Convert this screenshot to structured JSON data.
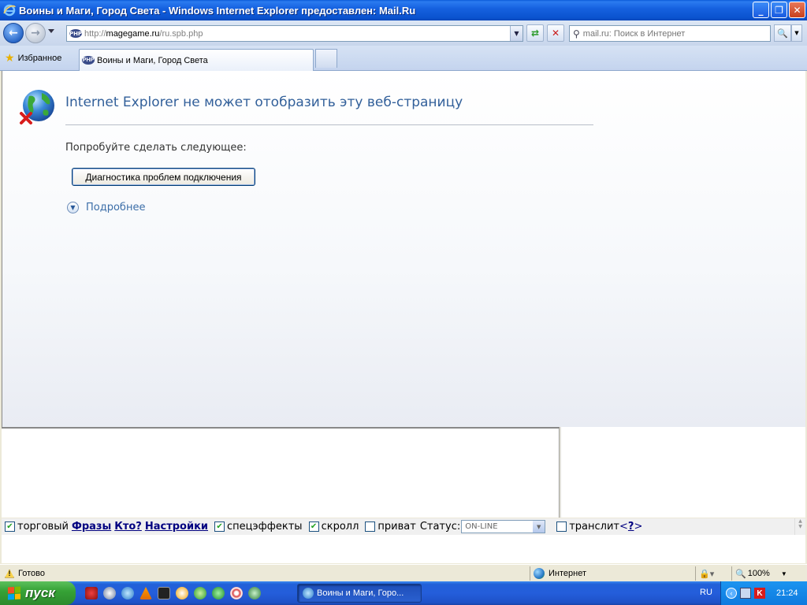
{
  "window": {
    "title": "Воины и Маги, Город Света - Windows Internet Explorer предоставлен: Mail.Ru",
    "buttons": {
      "minimize": "_",
      "maximize": "❐",
      "close": "✕"
    }
  },
  "address_bar": {
    "url_proto": "http://",
    "url_host": "magegame.ru",
    "url_rest": "/ru.spb.php",
    "site_icon": "PHP"
  },
  "search": {
    "placeholder": "mail.ru: Поиск в Интернет"
  },
  "favorites": {
    "label": "Избранное"
  },
  "tab": {
    "title": "Воины и Маги, Город Света",
    "icon": "PHP"
  },
  "error_page": {
    "title": "Internet Explorer не может отобразить эту веб-страницу",
    "suggest": "Попробуйте сделать следующее:",
    "diagnose_button": "Диагностика проблем подключения",
    "more_info": "Подробнее"
  },
  "chat_bar": {
    "trade": {
      "label": "торговый",
      "checked": true
    },
    "phrases_link": "Фразы",
    "who_link": "Кто?",
    "settings_link": "Настройки",
    "effects": {
      "label": "спецэффекты",
      "checked": true
    },
    "scroll": {
      "label": "скролл",
      "checked": true
    },
    "private": {
      "label": "приват",
      "checked": false
    },
    "status_label": "Статус:",
    "status_value": "ON-LINE",
    "translit": {
      "label": "транслит",
      "checked": false
    },
    "help_open": "<",
    "help_link": "?",
    "help_close": ">"
  },
  "status_bar": {
    "text": "Готово",
    "zone": "Интернет",
    "zoom": "100%"
  },
  "taskbar": {
    "start_label": "пуск",
    "task_label": "Воины и Маги, Горо...",
    "lang": "RU",
    "clock": "21:24"
  },
  "colors": {
    "title_text": "#32609A",
    "link": "#000080",
    "check": "#21A121",
    "start_green": "#36A236",
    "taskbar_blue": "#245EDB"
  }
}
